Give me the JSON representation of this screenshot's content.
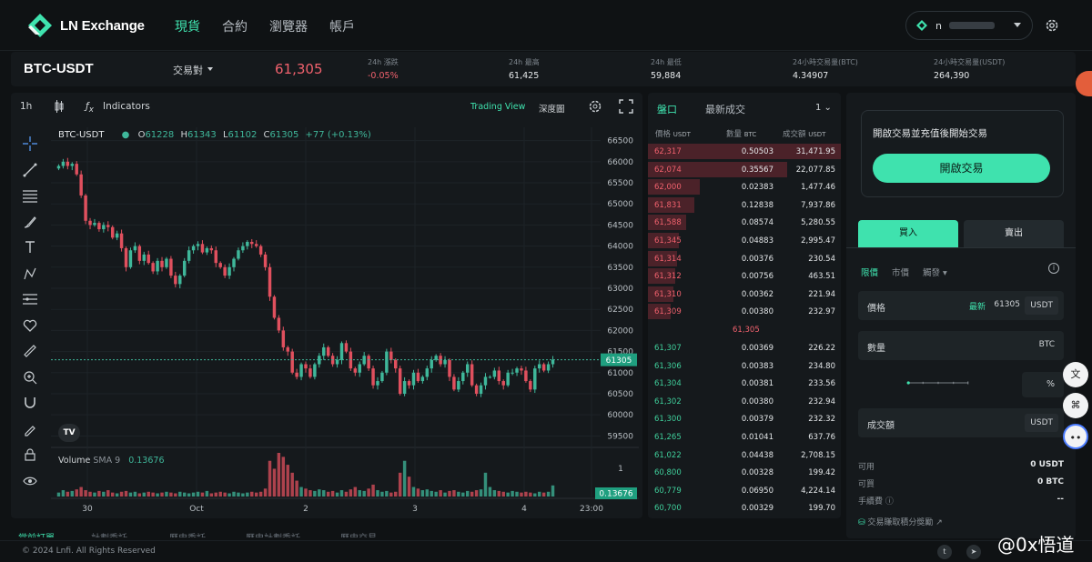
{
  "brand": {
    "name": "LN Exchange"
  },
  "nav": [
    "現貨",
    "合約",
    "瀏覽器",
    "帳戶"
  ],
  "user": {
    "name": "n"
  },
  "ticker": {
    "symbol": "BTC-USDT",
    "pair_label": "交易對",
    "price": "61,305",
    "stats": [
      {
        "label": "24h 漲跌",
        "value": "-0.05%"
      },
      {
        "label": "24h 最高",
        "value": "61,425"
      },
      {
        "label": "24h 最低",
        "value": "59,884"
      },
      {
        "label": "24小時交易量(BTC)",
        "value": "4.34907"
      },
      {
        "label": "24小時交易量(USDT)",
        "value": "264,390"
      }
    ]
  },
  "chart_toolbar": {
    "interval": "1h",
    "indicators": "Indicators",
    "trading_view": "Trading View",
    "depth": "深度圖"
  },
  "chart_data": {
    "type": "candlestick",
    "symbol": "BTC-USDT",
    "ohlc": {
      "o": "61228",
      "h": "61343",
      "l": "61102",
      "c": "61305",
      "chg": "+77 (+0.13%)"
    },
    "y_ticks": [
      "66500",
      "66000",
      "65500",
      "65000",
      "64500",
      "64000",
      "63500",
      "63000",
      "62500",
      "62000",
      "61500",
      "61000",
      "60500",
      "60000",
      "59500"
    ],
    "ylim": [
      59400,
      66600
    ],
    "current_price": "61305",
    "x_ticks": [
      "30",
      "Oct",
      "2",
      "3",
      "4",
      "23:00"
    ],
    "volume": {
      "label": "Volume",
      "sma": "SMA 9",
      "value": "0.13676",
      "axis_tick": "1"
    },
    "closes": [
      65900,
      66000,
      65900,
      65950,
      65700,
      65200,
      64600,
      64500,
      64550,
      64400,
      64500,
      64450,
      64200,
      64300,
      63950,
      63500,
      63900,
      64000,
      63650,
      63800,
      63600,
      63400,
      63650,
      63500,
      63700,
      63300,
      63100,
      63300,
      63650,
      63900,
      64000,
      64050,
      63850,
      63950,
      63900,
      63600,
      63500,
      63300,
      63500,
      63700,
      63900,
      64000,
      64100,
      64050,
      64000,
      63800,
      63500,
      62800,
      62300,
      62000,
      61600,
      61500,
      61000,
      60900,
      61200,
      61100,
      60900,
      61200,
      61400,
      61600,
      61400,
      61200,
      61300,
      61700,
      61500,
      61100,
      61000,
      61200,
      61400,
      61100,
      60700,
      60800,
      61000,
      61500,
      61300,
      61100,
      60500,
      60800,
      60700,
      61000,
      60800,
      60900,
      61100,
      61300,
      61400,
      61200,
      61300,
      60900,
      60600,
      60800,
      61000,
      61200,
      60700,
      60500,
      60700,
      60900,
      60900,
      61050,
      60800,
      60700,
      61000,
      61000,
      61100,
      61050,
      60800,
      60600,
      61100,
      61200,
      61050,
      61200,
      61305
    ],
    "volumes": [
      0.05,
      0.08,
      0.06,
      0.07,
      0.09,
      0.12,
      0.08,
      0.06,
      0.05,
      0.07,
      0.06,
      0.08,
      0.05,
      0.04,
      0.06,
      0.07,
      0.05,
      0.06,
      0.04,
      0.05,
      0.06,
      0.05,
      0.04,
      0.05,
      0.06,
      0.05,
      0.04,
      0.06,
      0.05,
      0.04,
      0.05,
      0.06,
      0.05,
      0.07,
      0.04,
      0.05,
      0.06,
      0.05,
      0.04,
      0.06,
      0.05,
      0.04,
      0.05,
      0.06,
      0.05,
      0.06,
      0.1,
      0.45,
      0.35,
      0.55,
      0.5,
      0.4,
      0.3,
      0.2,
      0.12,
      0.1,
      0.08,
      0.07,
      0.09,
      0.08,
      0.06,
      0.07,
      0.05,
      0.08,
      0.06,
      0.09,
      0.12,
      0.08,
      0.07,
      0.1,
      0.15,
      0.08,
      0.06,
      0.07,
      0.05,
      0.06,
      0.3,
      0.45,
      0.25,
      0.12,
      0.1,
      0.08,
      0.09,
      0.07,
      0.06,
      0.08,
      0.05,
      0.07,
      0.08,
      0.06,
      0.05,
      0.07,
      0.06,
      0.08,
      0.09,
      0.3,
      0.12,
      0.08,
      0.07,
      0.06,
      0.05,
      0.07,
      0.06,
      0.05,
      0.06,
      0.05,
      0.04,
      0.06,
      0.05,
      0.06,
      0.14
    ]
  },
  "orderbook": {
    "tab_book": "盤口",
    "tab_trades": "最新成交",
    "precision": "1",
    "headers": {
      "price": "價格",
      "price_unit": "USDT",
      "amount": "數量",
      "amount_unit": "BTC",
      "total": "成交額",
      "total_unit": "USDT"
    },
    "asks": [
      {
        "p": "62,317",
        "a": "0.50503",
        "t": "31,471.95",
        "d": 1.0
      },
      {
        "p": "62,074",
        "a": "0.35567",
        "t": "22,077.85",
        "d": 0.72
      },
      {
        "p": "62,000",
        "a": "0.02383",
        "t": "1,477.46",
        "d": 0.27
      },
      {
        "p": "61,831",
        "a": "0.12838",
        "t": "7,937.86",
        "d": 0.24
      },
      {
        "p": "61,588",
        "a": "0.08574",
        "t": "5,280.55",
        "d": 0.2
      },
      {
        "p": "61,345",
        "a": "0.04883",
        "t": "2,995.47",
        "d": 0.16
      },
      {
        "p": "61,314",
        "a": "0.00376",
        "t": "230.54",
        "d": 0.15
      },
      {
        "p": "61,312",
        "a": "0.00756",
        "t": "463.51",
        "d": 0.14
      },
      {
        "p": "61,310",
        "a": "0.00362",
        "t": "221.94",
        "d": 0.13
      },
      {
        "p": "61,309",
        "a": "0.00380",
        "t": "232.97",
        "d": 0.12
      }
    ],
    "mid": "61,305",
    "bids": [
      {
        "p": "61,307",
        "a": "0.00369",
        "t": "226.22"
      },
      {
        "p": "61,306",
        "a": "0.00383",
        "t": "234.80"
      },
      {
        "p": "61,304",
        "a": "0.00381",
        "t": "233.56"
      },
      {
        "p": "61,302",
        "a": "0.00380",
        "t": "232.94"
      },
      {
        "p": "61,300",
        "a": "0.00379",
        "t": "232.32"
      },
      {
        "p": "61,265",
        "a": "0.01041",
        "t": "637.76"
      },
      {
        "p": "61,022",
        "a": "0.04438",
        "t": "2,708.15"
      },
      {
        "p": "60,800",
        "a": "0.00328",
        "t": "199.42"
      },
      {
        "p": "60,779",
        "a": "0.06950",
        "t": "4,224.14"
      },
      {
        "p": "60,700",
        "a": "0.00329",
        "t": "199.70"
      }
    ]
  },
  "trade": {
    "promo_text": "開啟交易並充值後開始交易",
    "open_btn": "開啟交易",
    "buy": "買入",
    "sell": "賣出",
    "order_types": [
      "限價",
      "市價",
      "觸發"
    ],
    "price_label": "價格",
    "price_value": "61305",
    "price_latest": "最新",
    "price_unit": "USDT",
    "qty_label": "數量",
    "qty_unit": "BTC",
    "pct": "%",
    "amount_label": "成交額",
    "amount_unit": "USDT",
    "available_label": "可用",
    "available_value": "0 USDT",
    "buyable_label": "可買",
    "buyable_value": "0 BTC",
    "fee_label": "手續費",
    "fee_value": "--",
    "reward": "交易賺取積分獎勵"
  },
  "bottom_tabs": [
    "當前訂單",
    "計劃委託",
    "歷史委託",
    "歷史計劃委託",
    "歷史交易"
  ],
  "footer": {
    "copyright": "© 2024 Lnfi. All Rights Reserved"
  },
  "watermark": "@0x悟道",
  "colors": {
    "accent": "#3fe2ae",
    "up": "#3fb79a",
    "down": "#f0616d"
  }
}
